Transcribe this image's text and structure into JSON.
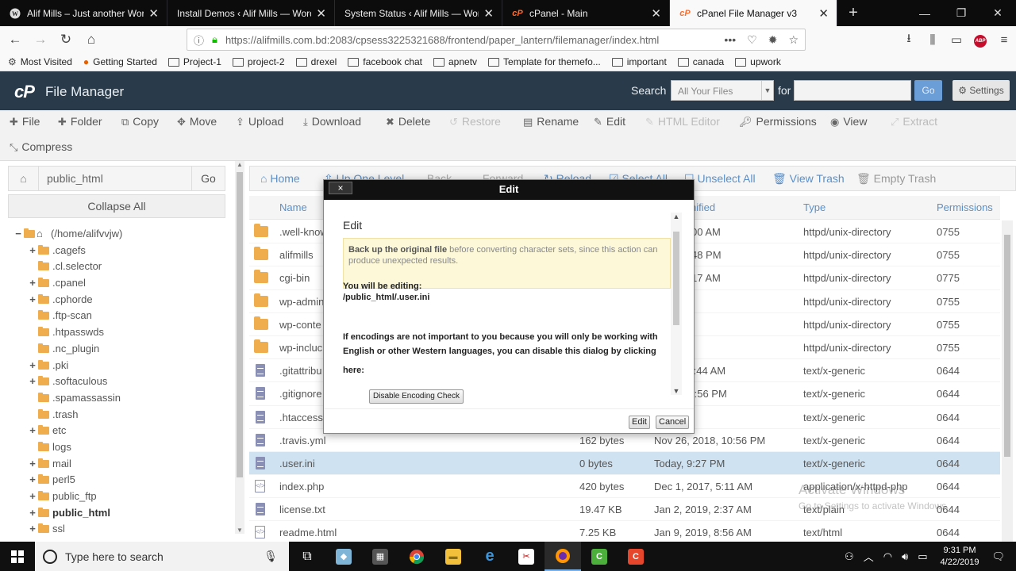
{
  "browser": {
    "tabs": [
      {
        "title": "Alif Mills – Just another WordPress",
        "icon": "wordpress-icon",
        "active": false
      },
      {
        "title": "Install Demos ‹ Alif Mills — WordPress",
        "icon": "",
        "active": false
      },
      {
        "title": "System Status ‹ Alif Mills — WordPress",
        "icon": "",
        "active": false
      },
      {
        "title": "cPanel - Main",
        "icon": "cpanel-icon",
        "active": false
      },
      {
        "title": "cPanel File Manager v3",
        "icon": "cpanel-icon",
        "active": true
      }
    ],
    "url": "https://alifmills.com.bd:2083/cpsess3225321688/frontend/paper_lantern/filemanager/index.html",
    "bookmarks": [
      "Most Visited",
      "Getting Started",
      "Project-1",
      "project-2",
      "drexel",
      "facebook chat",
      "apnetv",
      "Template for themefo...",
      "important",
      "canada",
      "upwork"
    ]
  },
  "header": {
    "logo": "cP",
    "title": "File Manager",
    "search_label": "Search",
    "search_scope": "All Your Files",
    "for_label": "for",
    "go_label": "Go",
    "settings_label": "Settings"
  },
  "toolbar": {
    "file": "File",
    "folder": "Folder",
    "copy": "Copy",
    "move": "Move",
    "upload": "Upload",
    "download": "Download",
    "delete": "Delete",
    "restore": "Restore",
    "rename": "Rename",
    "edit": "Edit",
    "html_editor": "HTML Editor",
    "permissions": "Permissions",
    "view": "View",
    "extract": "Extract",
    "compress": "Compress"
  },
  "sidebar": {
    "path_value": "public_html",
    "go_label": "Go",
    "collapse_label": "Collapse All",
    "tree": [
      {
        "label": "(/home/alifvvjw)",
        "expander": "−",
        "level": 0,
        "bold": false,
        "home": true
      },
      {
        "label": ".cagefs",
        "expander": "+",
        "level": 1,
        "bold": false
      },
      {
        "label": ".cl.selector",
        "expander": "",
        "level": 1,
        "bold": false
      },
      {
        "label": ".cpanel",
        "expander": "+",
        "level": 1,
        "bold": false
      },
      {
        "label": ".cphorde",
        "expander": "+",
        "level": 1,
        "bold": false
      },
      {
        "label": ".ftp-scan",
        "expander": "",
        "level": 1,
        "bold": false
      },
      {
        "label": ".htpasswds",
        "expander": "",
        "level": 1,
        "bold": false
      },
      {
        "label": ".nc_plugin",
        "expander": "",
        "level": 1,
        "bold": false
      },
      {
        "label": ".pki",
        "expander": "+",
        "level": 1,
        "bold": false
      },
      {
        "label": ".softaculous",
        "expander": "+",
        "level": 1,
        "bold": false
      },
      {
        "label": ".spamassassin",
        "expander": "",
        "level": 1,
        "bold": false
      },
      {
        "label": ".trash",
        "expander": "",
        "level": 1,
        "bold": false
      },
      {
        "label": "etc",
        "expander": "+",
        "level": 1,
        "bold": false
      },
      {
        "label": "logs",
        "expander": "",
        "level": 1,
        "bold": false
      },
      {
        "label": "mail",
        "expander": "+",
        "level": 1,
        "bold": false
      },
      {
        "label": "perl5",
        "expander": "+",
        "level": 1,
        "bold": false
      },
      {
        "label": "public_ftp",
        "expander": "+",
        "level": 1,
        "bold": false
      },
      {
        "label": "public_html",
        "expander": "+",
        "level": 1,
        "bold": true
      },
      {
        "label": "ssl",
        "expander": "+",
        "level": 1,
        "bold": false
      }
    ]
  },
  "filelist_toolbar": {
    "home": "Home",
    "up_one_level": "Up One Level",
    "back": "Back",
    "forward": "Forward",
    "reload": "Reload",
    "select_all": "Select All",
    "unselect_all": "Unselect All",
    "view_trash": "View Trash",
    "empty_trash": "Empty Trash"
  },
  "columns": {
    "name": "Name",
    "last_modified": "nified",
    "type": "Type",
    "permissions": "Permissions"
  },
  "files": [
    {
      "name": ".well-know",
      "size": "",
      "modified": "2018, 6:00 AM",
      "type": "httpd/unix-directory",
      "perms": "0755",
      "kind": "folder",
      "selected": false
    },
    {
      "name": "alifmills",
      "size": "",
      "modified": "2019, 3:48 PM",
      "type": "httpd/unix-directory",
      "perms": "0755",
      "kind": "folder",
      "selected": false
    },
    {
      "name": "cgi-bin",
      "size": "",
      "modified": "2018, 6:17 AM",
      "type": "httpd/unix-directory",
      "perms": "0775",
      "kind": "folder",
      "selected": false
    },
    {
      "name": "wp-admin",
      "size": "",
      "modified": "51 AM",
      "type": "httpd/unix-directory",
      "perms": "0755",
      "kind": "folder",
      "selected": false
    },
    {
      "name": "wp-conte",
      "size": "",
      "modified": "31 PM",
      "type": "httpd/unix-directory",
      "perms": "0755",
      "kind": "folder",
      "selected": false
    },
    {
      "name": "wp-incluc",
      "size": "",
      "modified": "51 PM",
      "type": "httpd/unix-directory",
      "perms": "0755",
      "kind": "folder",
      "selected": false
    },
    {
      "name": ".gitattribu",
      "size": "",
      "modified": "2018, 11:44 AM",
      "type": "text/x-generic",
      "perms": "0644",
      "kind": "doc",
      "selected": false
    },
    {
      "name": ".gitignore",
      "size": "",
      "modified": "2018, 10:56 PM",
      "type": "text/x-generic",
      "perms": "0644",
      "kind": "doc",
      "selected": false
    },
    {
      "name": ".htaccess",
      "size": "",
      "modified": "54 AM",
      "type": "text/x-generic",
      "perms": "0644",
      "kind": "doc",
      "selected": false
    },
    {
      "name": ".travis.yml",
      "size": "162 bytes",
      "modified": "Nov 26, 2018, 10:56 PM",
      "type": "text/x-generic",
      "perms": "0644",
      "kind": "doc",
      "selected": false
    },
    {
      "name": ".user.ini",
      "size": "0 bytes",
      "modified": "Today, 9:27 PM",
      "type": "text/x-generic",
      "perms": "0644",
      "kind": "doc",
      "selected": true
    },
    {
      "name": "index.php",
      "size": "420 bytes",
      "modified": "Dec 1, 2017, 5:11 AM",
      "type": "application/x-httpd-php",
      "perms": "0644",
      "kind": "php",
      "selected": false
    },
    {
      "name": "license.txt",
      "size": "19.47 KB",
      "modified": "Jan 2, 2019, 2:37 AM",
      "type": "text/plain",
      "perms": "0644",
      "kind": "doc",
      "selected": false
    },
    {
      "name": "readme.html",
      "size": "7.25 KB",
      "modified": "Jan 9, 2019, 8:56 AM",
      "type": "text/html",
      "perms": "0644",
      "kind": "php",
      "selected": false
    }
  ],
  "watermark": {
    "line1": "Activate Windows",
    "line2": "Go to Settings to activate Windows."
  },
  "modal": {
    "title": "Edit",
    "close_label": "×",
    "heading": "Edit",
    "warning_bold": "Back up the original file",
    "warning_rest": " before converting character sets, since this action can produce unexpected results.",
    "editing_label": "You will be editing:",
    "editing_path": "/public_html/.user.ini",
    "encoding_text": "If encodings are not important to you because you will only be working with English or other Western languages, you can disable this dialog by clicking",
    "here_label": "here:",
    "disable_button": "Disable Encoding Check",
    "edit_button": "Edit",
    "cancel_button": "Cancel"
  },
  "taskbar": {
    "search_placeholder": "Type here to search",
    "time": "9:31 PM",
    "date": "4/22/2019"
  },
  "colors": {
    "cpanel_header": "#293a4a",
    "link_blue": "#5b8fc7",
    "folder_orange": "#f0ad4e",
    "selected_row": "#cfe2f1"
  }
}
